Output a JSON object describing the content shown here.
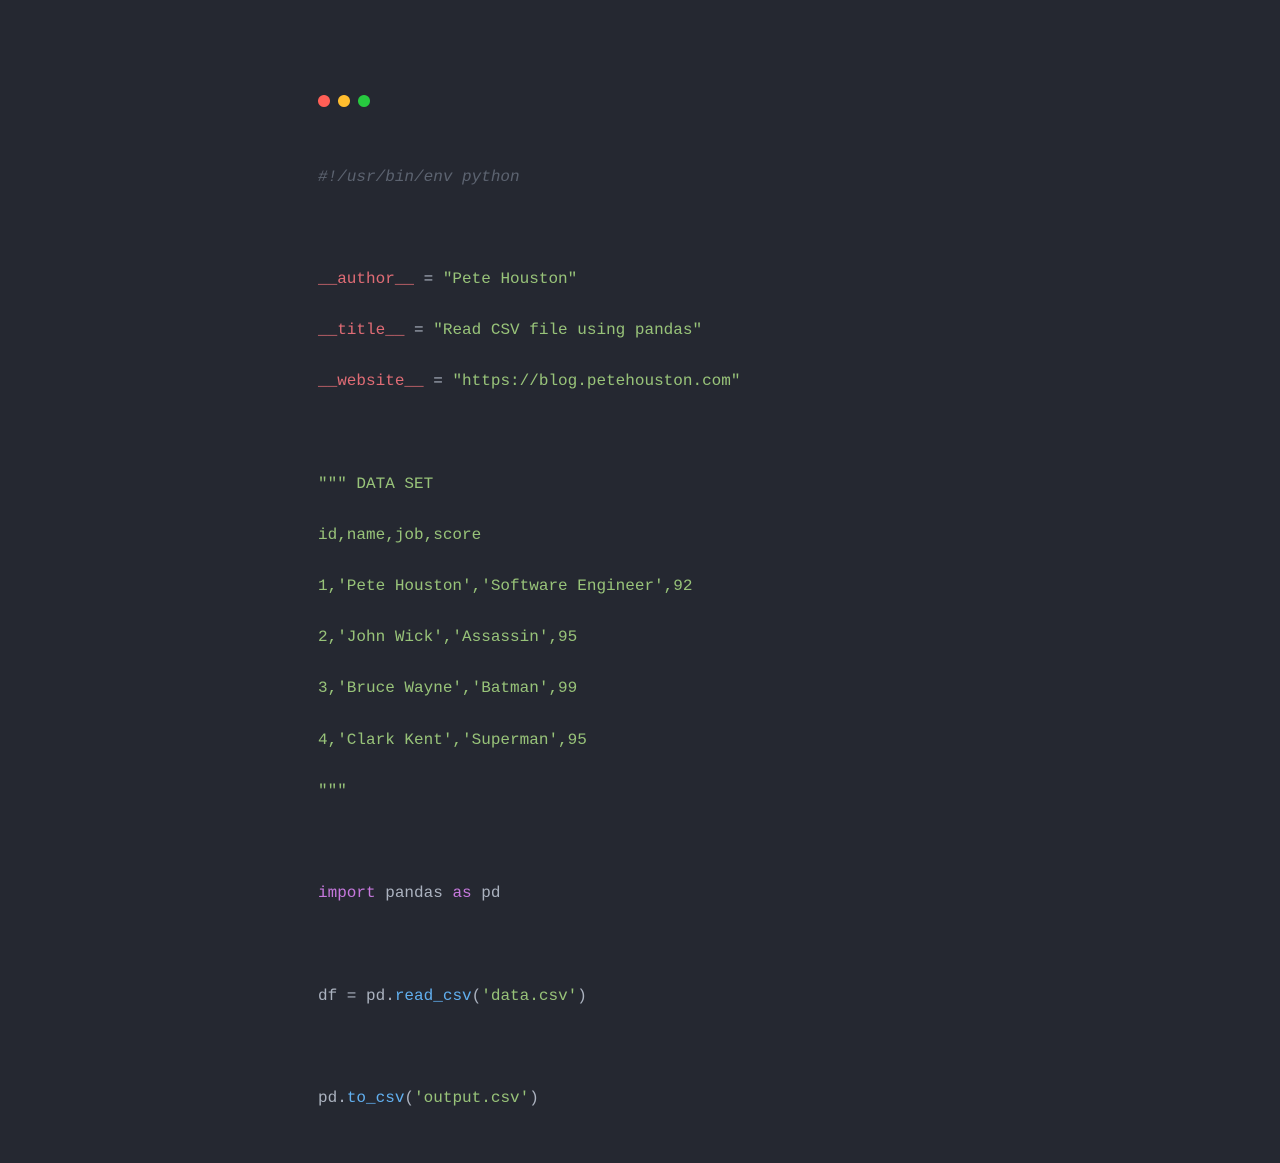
{
  "code": {
    "shebang": "#!/usr/bin/env python",
    "author_key": "__author__",
    "author_val": "\"Pete Houston\"",
    "title_key": "__title__",
    "title_val": "\"Read CSV file using pandas\"",
    "website_key": "__website__",
    "website_val": "\"https://blog.petehouston.com\"",
    "docstring_open": "\"\"\" DATA SET",
    "doc_line1": "id,name,job,score",
    "doc_line2": "1,'Pete Houston','Software Engineer',92",
    "doc_line3": "2,'John Wick','Assassin',95",
    "doc_line4": "3,'Bruce Wayne','Batman',99",
    "doc_line5": "4,'Clark Kent','Superman',95",
    "docstring_close": "\"\"\"",
    "import_kw": "import",
    "import_mod": "pandas",
    "as_kw": "as",
    "import_alias": "pd",
    "df_var": "df",
    "pd1": "pd",
    "read_csv": "read_csv",
    "read_csv_arg": "'data.csv'",
    "pd2": "pd",
    "to_csv": "to_csv",
    "to_csv_arg": "'output.csv'",
    "eq": " = ",
    "dot": ".",
    "lparen": "(",
    "rparen": ")"
  }
}
